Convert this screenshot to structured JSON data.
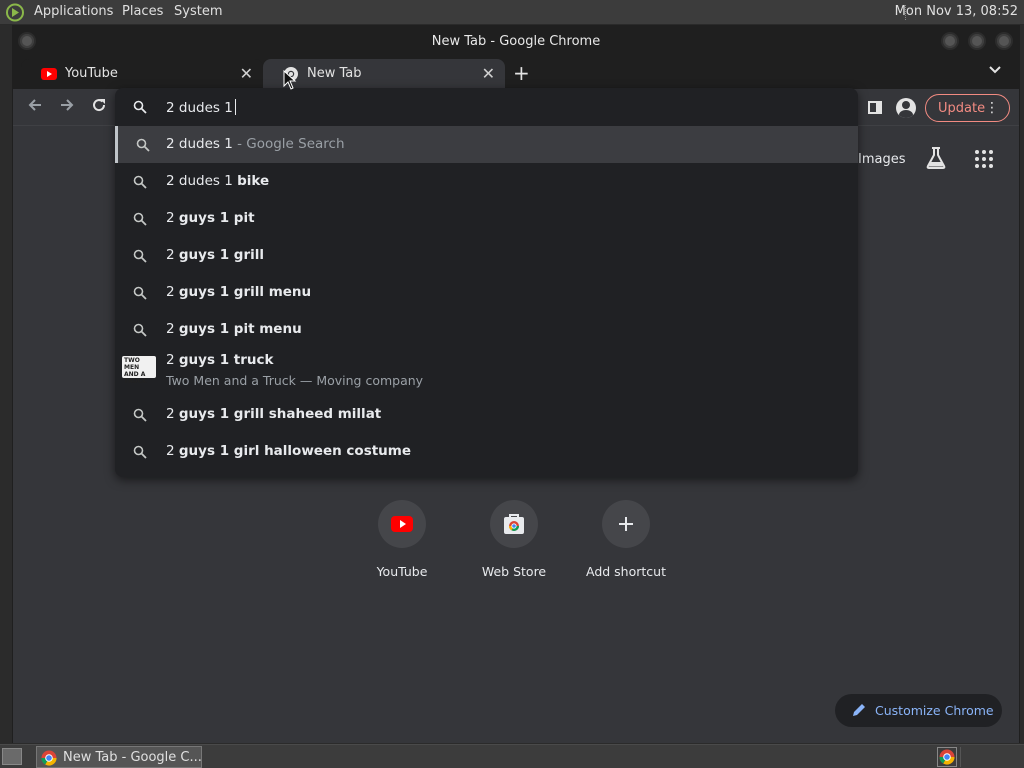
{
  "top_panel": {
    "menus": [
      "Applications",
      "Places",
      "System"
    ],
    "clock": "Mon Nov 13, 08:52"
  },
  "window": {
    "title": "New Tab - Google Chrome"
  },
  "tabs": [
    {
      "label": "YouTube",
      "icon": "youtube-icon",
      "active": false
    },
    {
      "label": "New Tab",
      "icon": "chrome-icon",
      "active": true
    }
  ],
  "toolbar": {
    "update_label": "Update"
  },
  "omnibox": {
    "input_value": "2 dudes 1",
    "suggestions": [
      {
        "prefix": "2 dudes 1",
        "bold": "",
        "suffix": " - Google Search",
        "selected": true
      },
      {
        "prefix": "2 dudes 1 ",
        "bold": "bike",
        "suffix": ""
      },
      {
        "prefix": "2 ",
        "bold": "guys 1 pit",
        "suffix": ""
      },
      {
        "prefix": "2 ",
        "bold": "guys 1 grill",
        "suffix": ""
      },
      {
        "prefix": "2 ",
        "bold": "guys 1 grill menu",
        "suffix": ""
      },
      {
        "prefix": "2 ",
        "bold": "guys 1 pit menu",
        "suffix": ""
      },
      {
        "prefix": "2 ",
        "bold": "guys 1 truck",
        "suffix": "",
        "subtitle": "Two Men and a Truck — Moving company",
        "thumb_text": "TWO MEN AND A TRUCK"
      },
      {
        "prefix": "2 ",
        "bold": "guys 1 grill shaheed millat",
        "suffix": ""
      },
      {
        "prefix": "2 ",
        "bold": "guys 1 girl halloween costume",
        "suffix": ""
      }
    ]
  },
  "ntp": {
    "images_link": "Images",
    "shortcuts": [
      {
        "label": "YouTube",
        "icon": "youtube-icon"
      },
      {
        "label": "Web Store",
        "icon": "web-store-icon"
      },
      {
        "label": "Add shortcut",
        "icon": "plus-icon"
      }
    ],
    "customize_label": "Customize Chrome"
  },
  "taskbar": {
    "task_label": "New Tab - Google C..."
  },
  "colors": {
    "accent_blue": "#8ab4f8",
    "update_red": "#f28b82",
    "youtube_red": "#ff0000"
  }
}
